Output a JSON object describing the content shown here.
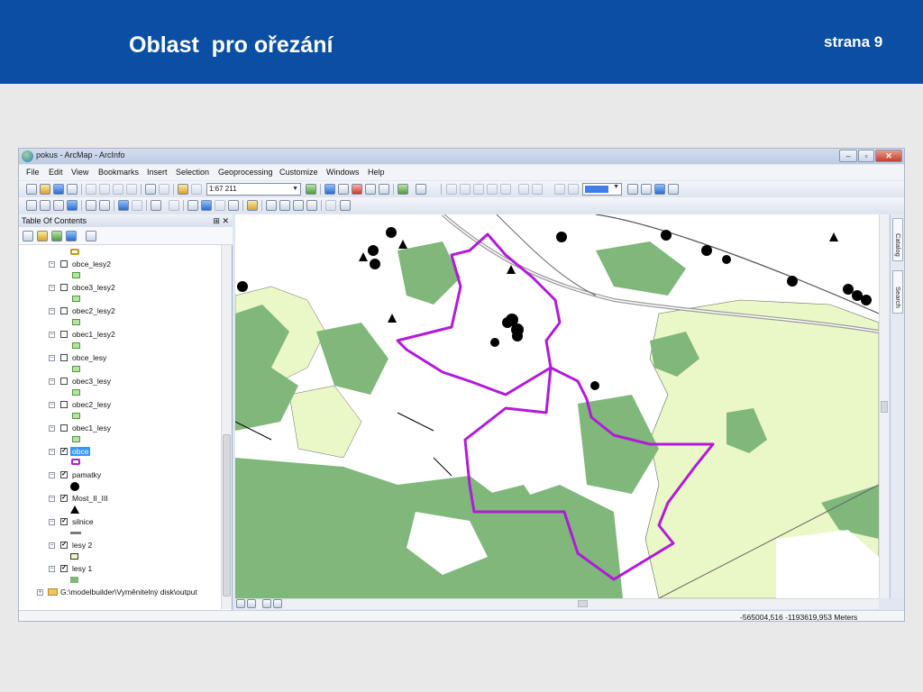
{
  "slide": {
    "title": "Oblast  pro ořezání",
    "page_label": "strana 9"
  },
  "window": {
    "title": "pokus - ArcMap - ArcInfo",
    "controls": [
      "–",
      "▫",
      "✕"
    ]
  },
  "menu": [
    "File",
    "Edit",
    "View",
    "Bookmarks",
    "Insert",
    "Selection",
    "Geoprocessing",
    "Customize",
    "Windows",
    "Help"
  ],
  "toolbar": {
    "scale_value": "1:67 211"
  },
  "toc": {
    "title": "Table Of Contents",
    "header_tail": "⊞ ✕",
    "layers": [
      {
        "name": "obce_lesy2",
        "checked": false,
        "symbol": "poly-green"
      },
      {
        "name": "obce3_lesy2",
        "checked": false,
        "symbol": "poly-green"
      },
      {
        "name": "obec2_lesy2",
        "checked": false,
        "symbol": "poly-green"
      },
      {
        "name": "obec1_lesy2",
        "checked": false,
        "symbol": "poly-green"
      },
      {
        "name": "obce_lesy",
        "checked": false,
        "symbol": "poly-green"
      },
      {
        "name": "obec3_lesy",
        "checked": false,
        "symbol": "poly-green"
      },
      {
        "name": "obec2_lesy",
        "checked": false,
        "symbol": "poly-green"
      },
      {
        "name": "obec1_lesy",
        "checked": false,
        "symbol": "poly-green"
      },
      {
        "name": "obce",
        "checked": true,
        "selected": true,
        "symbol": "outline-purple"
      },
      {
        "name": "pamatky",
        "checked": true,
        "symbol": "dot"
      },
      {
        "name": "Most_II_III",
        "checked": true,
        "symbol": "triangle"
      },
      {
        "name": "silnice",
        "checked": true,
        "symbol": "line"
      },
      {
        "name": "lesy 2",
        "checked": true,
        "symbol": "poly-light"
      },
      {
        "name": "lesy 1",
        "checked": true,
        "symbol": "poly-dark"
      }
    ],
    "folder": "G:\\modelbuilder\\Vyměnitelný disk\\output"
  },
  "side_tabs": [
    "Catalog",
    "Search"
  ],
  "status": {
    "coordinates": "-565004,516  -1193619,953 Meters"
  },
  "colors": {
    "header_blue": "#0a4fa3",
    "forest_dark": "#7fb87a",
    "forest_light": "#eaf7c6",
    "boundary_purple": "#b21ad8"
  }
}
